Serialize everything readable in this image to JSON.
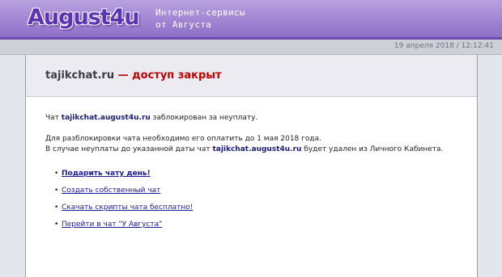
{
  "header": {
    "logo": "August4u",
    "tagline_line1": "Интернет-сервисы",
    "tagline_line2": "от Августа"
  },
  "datebar": {
    "datetime": "19 апреля 2018 / 12:12:41"
  },
  "page": {
    "title_site": "tajikchat.ru",
    "title_status": "— доступ закрыт",
    "line1_prefix": "Чат ",
    "chat_domain": "tajikchat.august4u.ru",
    "line1_suffix": " заблокирован за неуплату.",
    "line2": "Для разблокировки чата необходимо его оплатить до 1 мая 2018 года.",
    "line3_prefix": "В случае неуплаты до указанной даты чат ",
    "line3_suffix": " будет удален из Личного Кабинета."
  },
  "links": [
    {
      "label": "Подарить чату день!"
    },
    {
      "label": "Создать собственный чат"
    },
    {
      "label": "Скачать скрипты чата бесплатно!"
    },
    {
      "label": "Перейти в чат \"У Августа\""
    }
  ],
  "colors": {
    "header": "#a185d4",
    "logo": "#5b33b4",
    "status": "#c00000",
    "link": "#1a1aa0"
  }
}
